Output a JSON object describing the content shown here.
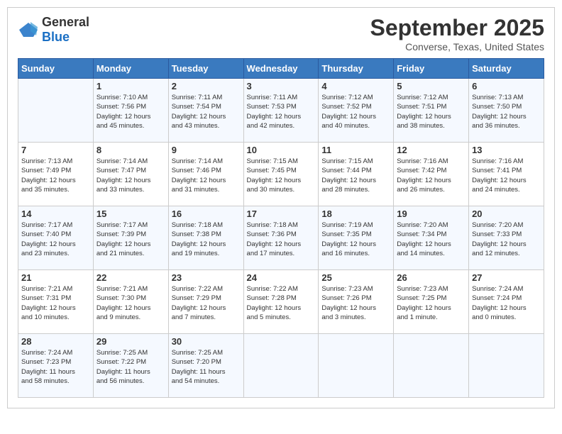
{
  "logo": {
    "text_general": "General",
    "text_blue": "Blue"
  },
  "header": {
    "month": "September 2025",
    "location": "Converse, Texas, United States"
  },
  "weekdays": [
    "Sunday",
    "Monday",
    "Tuesday",
    "Wednesday",
    "Thursday",
    "Friday",
    "Saturday"
  ],
  "weeks": [
    [
      {
        "day": "",
        "content": ""
      },
      {
        "day": "1",
        "content": "Sunrise: 7:10 AM\nSunset: 7:56 PM\nDaylight: 12 hours\nand 45 minutes."
      },
      {
        "day": "2",
        "content": "Sunrise: 7:11 AM\nSunset: 7:54 PM\nDaylight: 12 hours\nand 43 minutes."
      },
      {
        "day": "3",
        "content": "Sunrise: 7:11 AM\nSunset: 7:53 PM\nDaylight: 12 hours\nand 42 minutes."
      },
      {
        "day": "4",
        "content": "Sunrise: 7:12 AM\nSunset: 7:52 PM\nDaylight: 12 hours\nand 40 minutes."
      },
      {
        "day": "5",
        "content": "Sunrise: 7:12 AM\nSunset: 7:51 PM\nDaylight: 12 hours\nand 38 minutes."
      },
      {
        "day": "6",
        "content": "Sunrise: 7:13 AM\nSunset: 7:50 PM\nDaylight: 12 hours\nand 36 minutes."
      }
    ],
    [
      {
        "day": "7",
        "content": "Sunrise: 7:13 AM\nSunset: 7:49 PM\nDaylight: 12 hours\nand 35 minutes."
      },
      {
        "day": "8",
        "content": "Sunrise: 7:14 AM\nSunset: 7:47 PM\nDaylight: 12 hours\nand 33 minutes."
      },
      {
        "day": "9",
        "content": "Sunrise: 7:14 AM\nSunset: 7:46 PM\nDaylight: 12 hours\nand 31 minutes."
      },
      {
        "day": "10",
        "content": "Sunrise: 7:15 AM\nSunset: 7:45 PM\nDaylight: 12 hours\nand 30 minutes."
      },
      {
        "day": "11",
        "content": "Sunrise: 7:15 AM\nSunset: 7:44 PM\nDaylight: 12 hours\nand 28 minutes."
      },
      {
        "day": "12",
        "content": "Sunrise: 7:16 AM\nSunset: 7:42 PM\nDaylight: 12 hours\nand 26 minutes."
      },
      {
        "day": "13",
        "content": "Sunrise: 7:16 AM\nSunset: 7:41 PM\nDaylight: 12 hours\nand 24 minutes."
      }
    ],
    [
      {
        "day": "14",
        "content": "Sunrise: 7:17 AM\nSunset: 7:40 PM\nDaylight: 12 hours\nand 23 minutes."
      },
      {
        "day": "15",
        "content": "Sunrise: 7:17 AM\nSunset: 7:39 PM\nDaylight: 12 hours\nand 21 minutes."
      },
      {
        "day": "16",
        "content": "Sunrise: 7:18 AM\nSunset: 7:38 PM\nDaylight: 12 hours\nand 19 minutes."
      },
      {
        "day": "17",
        "content": "Sunrise: 7:18 AM\nSunset: 7:36 PM\nDaylight: 12 hours\nand 17 minutes."
      },
      {
        "day": "18",
        "content": "Sunrise: 7:19 AM\nSunset: 7:35 PM\nDaylight: 12 hours\nand 16 minutes."
      },
      {
        "day": "19",
        "content": "Sunrise: 7:20 AM\nSunset: 7:34 PM\nDaylight: 12 hours\nand 14 minutes."
      },
      {
        "day": "20",
        "content": "Sunrise: 7:20 AM\nSunset: 7:33 PM\nDaylight: 12 hours\nand 12 minutes."
      }
    ],
    [
      {
        "day": "21",
        "content": "Sunrise: 7:21 AM\nSunset: 7:31 PM\nDaylight: 12 hours\nand 10 minutes."
      },
      {
        "day": "22",
        "content": "Sunrise: 7:21 AM\nSunset: 7:30 PM\nDaylight: 12 hours\nand 9 minutes."
      },
      {
        "day": "23",
        "content": "Sunrise: 7:22 AM\nSunset: 7:29 PM\nDaylight: 12 hours\nand 7 minutes."
      },
      {
        "day": "24",
        "content": "Sunrise: 7:22 AM\nSunset: 7:28 PM\nDaylight: 12 hours\nand 5 minutes."
      },
      {
        "day": "25",
        "content": "Sunrise: 7:23 AM\nSunset: 7:26 PM\nDaylight: 12 hours\nand 3 minutes."
      },
      {
        "day": "26",
        "content": "Sunrise: 7:23 AM\nSunset: 7:25 PM\nDaylight: 12 hours\nand 1 minute."
      },
      {
        "day": "27",
        "content": "Sunrise: 7:24 AM\nSunset: 7:24 PM\nDaylight: 12 hours\nand 0 minutes."
      }
    ],
    [
      {
        "day": "28",
        "content": "Sunrise: 7:24 AM\nSunset: 7:23 PM\nDaylight: 11 hours\nand 58 minutes."
      },
      {
        "day": "29",
        "content": "Sunrise: 7:25 AM\nSunset: 7:22 PM\nDaylight: 11 hours\nand 56 minutes."
      },
      {
        "day": "30",
        "content": "Sunrise: 7:25 AM\nSunset: 7:20 PM\nDaylight: 11 hours\nand 54 minutes."
      },
      {
        "day": "",
        "content": ""
      },
      {
        "day": "",
        "content": ""
      },
      {
        "day": "",
        "content": ""
      },
      {
        "day": "",
        "content": ""
      }
    ]
  ]
}
